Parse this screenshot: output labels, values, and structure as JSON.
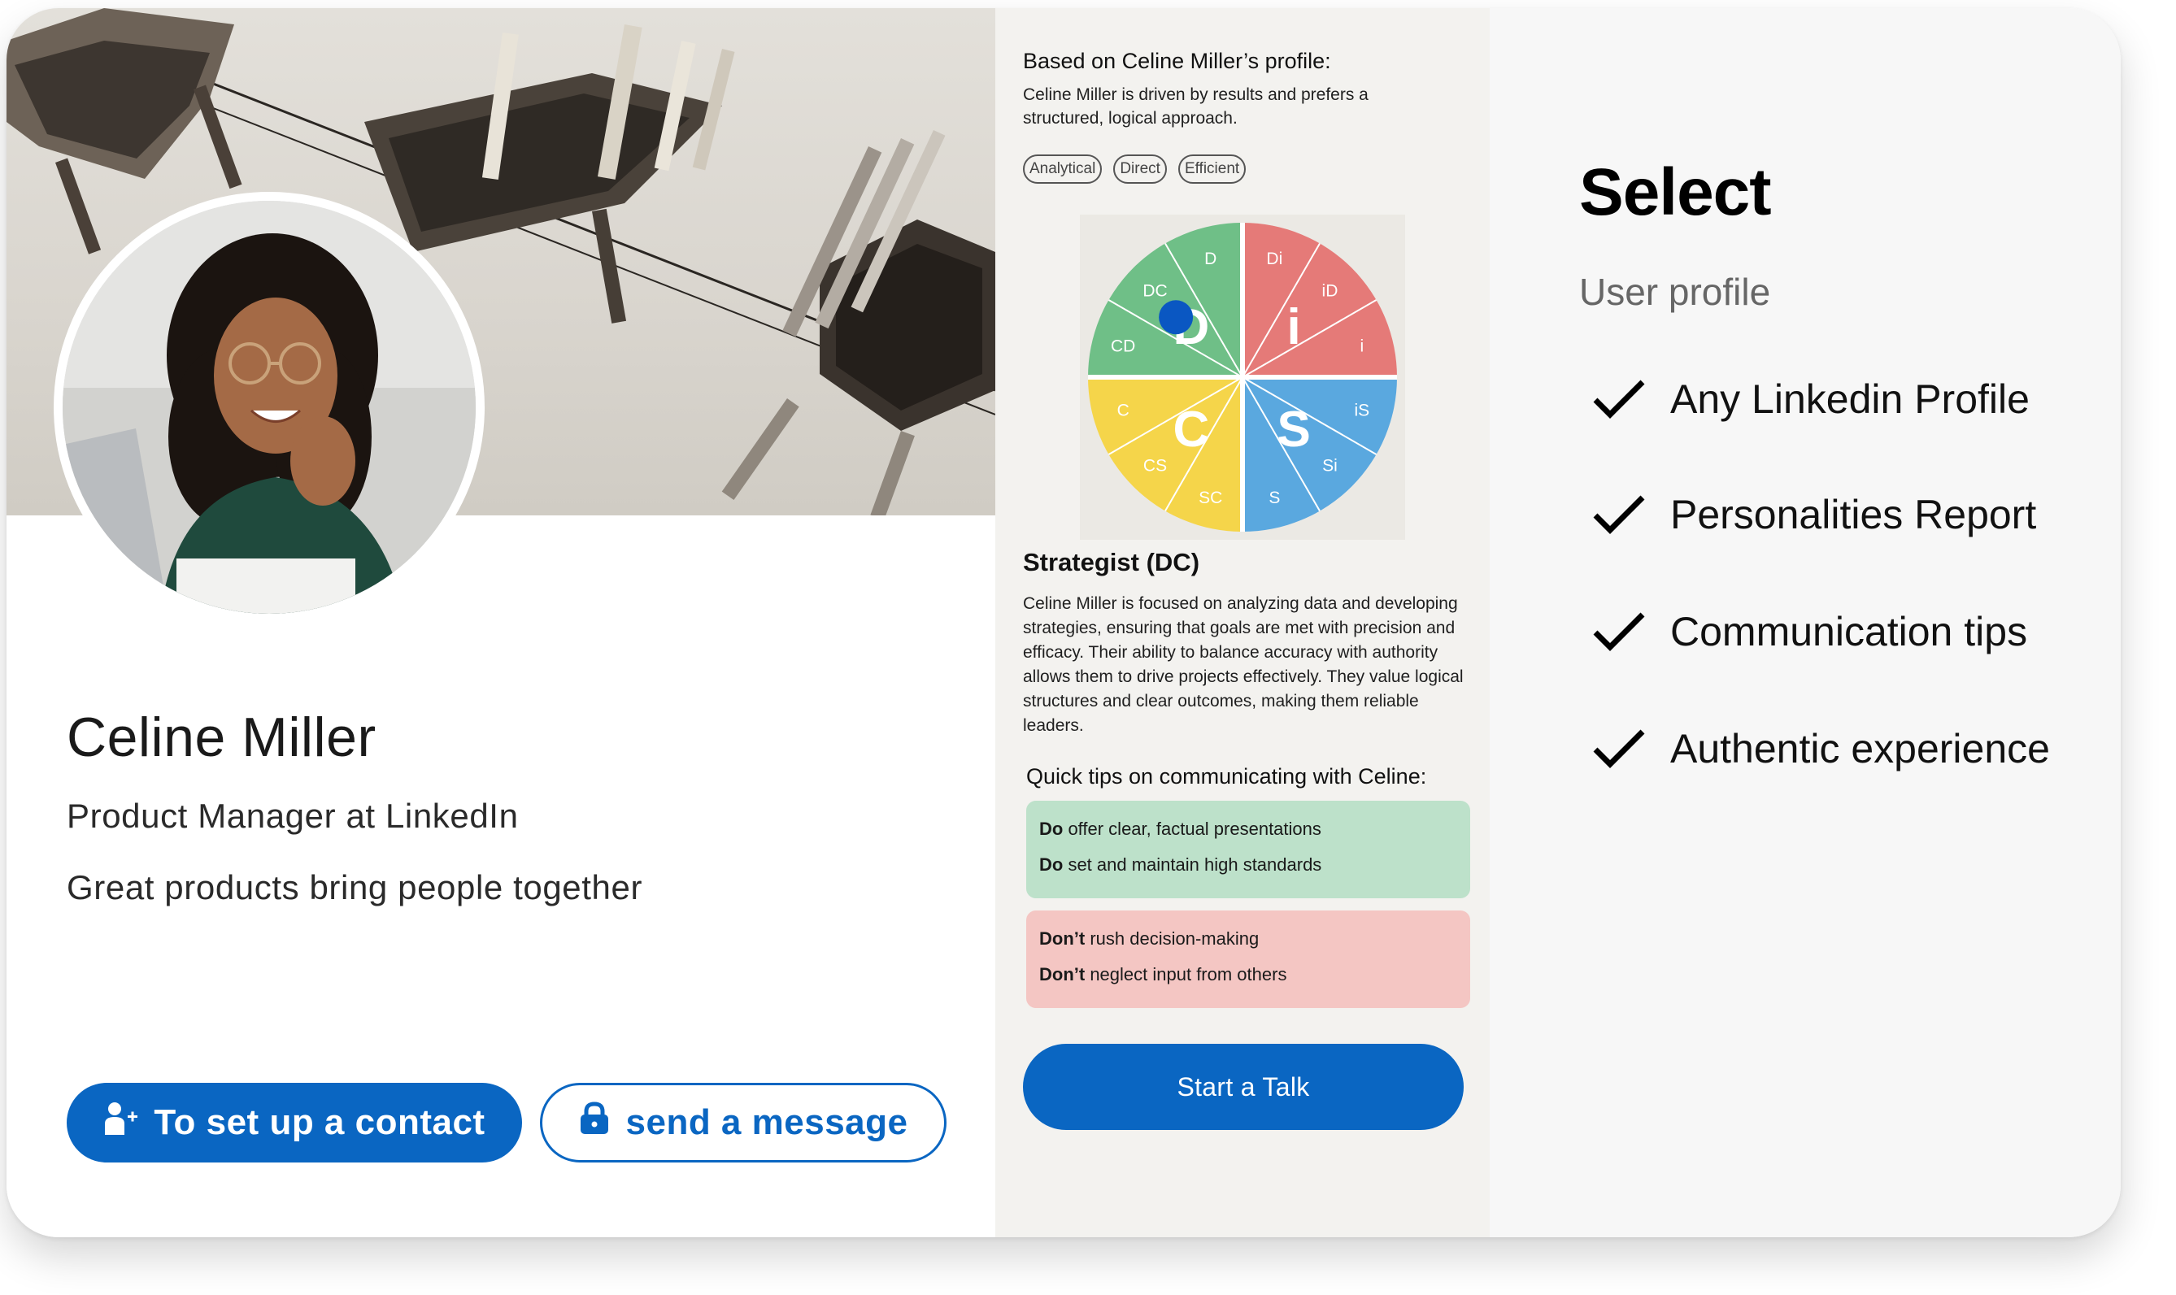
{
  "profile": {
    "name": "Celine Miller",
    "title": "Product Manager at LinkedIn",
    "tagline": "Great products bring people together",
    "contact_button": "To set up a contact",
    "message_button": "send a message"
  },
  "analysis": {
    "heading": "Based on Celine Miller’s profile:",
    "summary": "Celine Miller is driven by results and prefers a structured, logical approach.",
    "traits": [
      "Analytical",
      "Direct",
      "Efficient"
    ],
    "disc": {
      "segments": [
        {
          "label": "Di",
          "color": "#6fbf87"
        },
        {
          "label": "iD",
          "color": "#e57a78"
        },
        {
          "label": "i",
          "color": "#e57a78"
        },
        {
          "label": "iS",
          "color": "#e57a78"
        },
        {
          "label": "Si",
          "color": "#5aa8df"
        },
        {
          "label": "S",
          "color": "#5aa8df"
        },
        {
          "label": "SC",
          "color": "#5aa8df"
        },
        {
          "label": "CS",
          "color": "#f5d54a"
        },
        {
          "label": "C",
          "color": "#f5d54a"
        },
        {
          "label": "CD",
          "color": "#f5d54a"
        },
        {
          "label": "DC",
          "color": "#6fbf87"
        },
        {
          "label": "D",
          "color": "#6fbf87"
        }
      ],
      "quadrants": [
        "D",
        "i",
        "S",
        "C"
      ],
      "marker_color": "#0a57c2"
    },
    "type_title": "Strategist (DC)",
    "type_description": "Celine Miller is focused on analyzing data and developing strategies, ensuring that goals are met with precision and efficacy. Their ability to balance accuracy with authority allows them to drive projects effectively. They value logical structures and clear outcomes, making them reliable leaders.",
    "tips_title": "Quick tips on communicating with Celine:",
    "do_tips": [
      {
        "prefix": "Do",
        "text": " offer clear, factual presentations"
      },
      {
        "prefix": "Do",
        "text": " set and maintain high standards"
      }
    ],
    "dont_tips": [
      {
        "prefix": "Don’t",
        "text": " rush decision-making"
      },
      {
        "prefix": "Don’t",
        "text": " neglect input from others"
      }
    ],
    "talk_button": "Start a Talk"
  },
  "select": {
    "title": "Select",
    "subtitle": "User profile",
    "features": [
      "Any Linkedin Profile",
      "Personalities Report",
      "Communication tips",
      "Authentic experience"
    ]
  },
  "colors": {
    "brand_blue": "#0a66c2",
    "do_bg": "#bde1ca",
    "dont_bg": "#f4c6c3"
  }
}
